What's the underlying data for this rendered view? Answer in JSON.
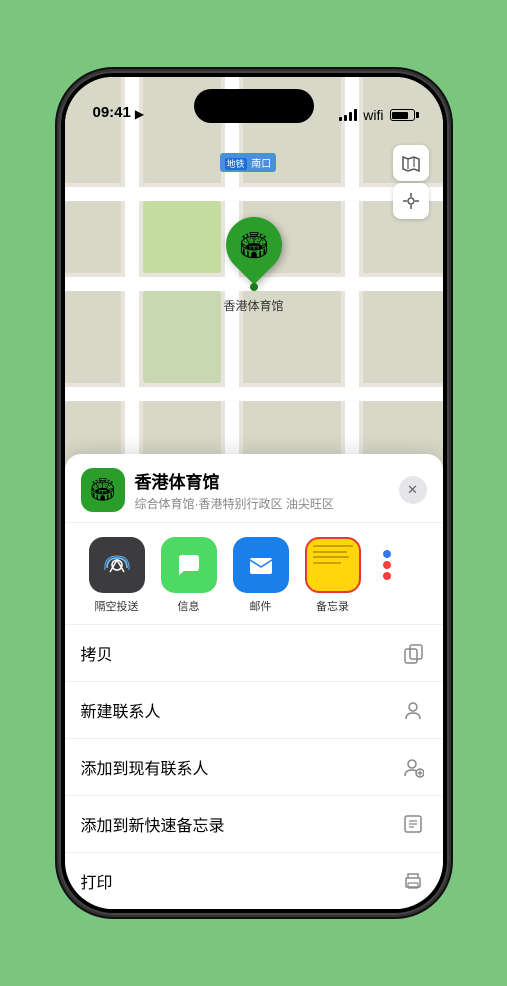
{
  "statusBar": {
    "time": "09:41",
    "locationArrow": "▶"
  },
  "mapControls": {
    "mapViewIcon": "🗺",
    "locationIcon": "◎"
  },
  "mapLabel": {
    "stationPrefix": "地铁",
    "stationName": "南口"
  },
  "locationPin": {
    "emoji": "🏟",
    "label": "香港体育馆"
  },
  "bottomSheet": {
    "venueEmoji": "🏟",
    "venueName": "香港体育馆",
    "venueSubtitle": "综合体育馆·香港特别行政区 油尖旺区",
    "closeLabel": "✕"
  },
  "shareApps": [
    {
      "id": "airdrop",
      "label": "隔空投送",
      "emoji": "📡"
    },
    {
      "id": "messages",
      "label": "信息",
      "emoji": "💬"
    },
    {
      "id": "mail",
      "label": "邮件",
      "emoji": "✉️"
    },
    {
      "id": "notes",
      "label": "备忘录"
    },
    {
      "id": "more",
      "label": ""
    }
  ],
  "actionItems": [
    {
      "id": "copy",
      "label": "拷贝",
      "iconUnicode": "⊙"
    },
    {
      "id": "add-contact",
      "label": "新建联系人",
      "iconUnicode": "👤"
    },
    {
      "id": "add-existing",
      "label": "添加到现有联系人",
      "iconUnicode": "👤"
    },
    {
      "id": "add-quicknote",
      "label": "添加到新快速备忘录",
      "iconUnicode": "📋"
    },
    {
      "id": "print",
      "label": "打印",
      "iconUnicode": "🖨"
    }
  ],
  "colors": {
    "green": "#2a9d2a",
    "mapBg": "#e8e8e4",
    "roadColor": "#ffffff",
    "blockColor": "#d8d8c8"
  }
}
